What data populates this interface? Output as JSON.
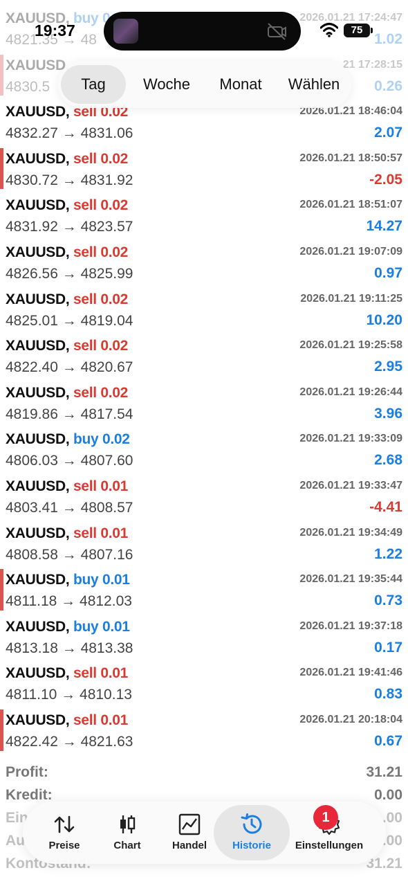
{
  "status_bar": {
    "time": "19:37",
    "battery": "75"
  },
  "period_tabs": [
    "Tag",
    "Woche",
    "Monat",
    "Wählen"
  ],
  "active_period": "Tag",
  "deals": [
    {
      "symbol": "XAUUSD,",
      "side": "buy",
      "side_label": "buy 0.0",
      "volume": "",
      "time": "2026.01.21 17:24:47",
      "prices": "4821.35 → 48",
      "profit": "1.02",
      "positive": true,
      "faded": true,
      "marked": false
    },
    {
      "symbol": "XAUUSD,",
      "side": "buy",
      "side_label": "",
      "volume": "",
      "time": "21 17:28:15",
      "prices": "4830.5",
      "profit": "0.26",
      "positive": true,
      "faded": true,
      "marked": true
    },
    {
      "symbol": "XAUUSD,",
      "side": "sell",
      "side_label": "sell 0.02",
      "time": "2026.01.21 18:46:04",
      "prices": "4832.27 → 4831.06",
      "profit": "2.07",
      "positive": true,
      "faded": false,
      "marked": false
    },
    {
      "symbol": "XAUUSD,",
      "side": "sell",
      "side_label": "sell 0.02",
      "time": "2026.01.21 18:50:57",
      "prices": "4830.72 → 4831.92",
      "profit": "-2.05",
      "positive": false,
      "faded": false,
      "marked": true
    },
    {
      "symbol": "XAUUSD,",
      "side": "sell",
      "side_label": "sell 0.02",
      "time": "2026.01.21 18:51:07",
      "prices": "4831.92 → 4823.57",
      "profit": "14.27",
      "positive": true,
      "faded": false,
      "marked": false
    },
    {
      "symbol": "XAUUSD,",
      "side": "sell",
      "side_label": "sell 0.02",
      "time": "2026.01.21 19:07:09",
      "prices": "4826.56 → 4825.99",
      "profit": "0.97",
      "positive": true,
      "faded": false,
      "marked": false
    },
    {
      "symbol": "XAUUSD,",
      "side": "sell",
      "side_label": "sell 0.02",
      "time": "2026.01.21 19:11:25",
      "prices": "4825.01 → 4819.04",
      "profit": "10.20",
      "positive": true,
      "faded": false,
      "marked": false
    },
    {
      "symbol": "XAUUSD,",
      "side": "sell",
      "side_label": "sell 0.02",
      "time": "2026.01.21 19:25:58",
      "prices": "4822.40 → 4820.67",
      "profit": "2.95",
      "positive": true,
      "faded": false,
      "marked": false
    },
    {
      "symbol": "XAUUSD,",
      "side": "sell",
      "side_label": "sell 0.02",
      "time": "2026.01.21 19:26:44",
      "prices": "4819.86 → 4817.54",
      "profit": "3.96",
      "positive": true,
      "faded": false,
      "marked": false
    },
    {
      "symbol": "XAUUSD,",
      "side": "buy",
      "side_label": "buy 0.02",
      "time": "2026.01.21 19:33:09",
      "prices": "4806.03 → 4807.60",
      "profit": "2.68",
      "positive": true,
      "faded": false,
      "marked": false
    },
    {
      "symbol": "XAUUSD,",
      "side": "sell",
      "side_label": "sell 0.01",
      "time": "2026.01.21 19:33:47",
      "prices": "4803.41 → 4808.57",
      "profit": "-4.41",
      "positive": false,
      "faded": false,
      "marked": false
    },
    {
      "symbol": "XAUUSD,",
      "side": "sell",
      "side_label": "sell 0.01",
      "time": "2026.01.21 19:34:49",
      "prices": "4808.58 → 4807.16",
      "profit": "1.22",
      "positive": true,
      "faded": false,
      "marked": false
    },
    {
      "symbol": "XAUUSD,",
      "side": "buy",
      "side_label": "buy 0.01",
      "time": "2026.01.21 19:35:44",
      "prices": "4811.18 → 4812.03",
      "profit": "0.73",
      "positive": true,
      "faded": false,
      "marked": true
    },
    {
      "symbol": "XAUUSD,",
      "side": "buy",
      "side_label": "buy 0.01",
      "time": "2026.01.21 19:37:18",
      "prices": "4813.18 → 4813.38",
      "profit": "0.17",
      "positive": true,
      "faded": false,
      "marked": false
    },
    {
      "symbol": "XAUUSD,",
      "side": "sell",
      "side_label": "sell 0.01",
      "time": "2026.01.21 19:41:46",
      "prices": "4811.10 → 4810.13",
      "profit": "0.83",
      "positive": true,
      "faded": false,
      "marked": false
    },
    {
      "symbol": "XAUUSD,",
      "side": "sell",
      "side_label": "sell 0.01",
      "time": "2026.01.21 20:18:04",
      "prices": "4822.42 → 4821.63",
      "profit": "0.67",
      "positive": true,
      "faded": false,
      "marked": true
    }
  ],
  "summary": [
    {
      "label": "Profit:",
      "value": "31.21"
    },
    {
      "label": "Kredit:",
      "value": "0.00"
    },
    {
      "label": "Ein",
      "value": ".00"
    },
    {
      "label": "Au",
      "value": ".00"
    },
    {
      "label": "Kontostand:",
      "value": "31.21"
    }
  ],
  "nav": [
    {
      "label": "Preise",
      "icon": "sort-arrows-icon"
    },
    {
      "label": "Chart",
      "icon": "candlestick-icon"
    },
    {
      "label": "Handel",
      "icon": "trade-chart-icon"
    },
    {
      "label": "Historie",
      "icon": "history-clock-icon"
    },
    {
      "label": "Einstellungen",
      "icon": "gear-icon"
    }
  ],
  "active_nav": "Historie",
  "settings_badge": "1",
  "colors": {
    "sell": "#d93a32",
    "buy": "#1a7fe0",
    "badge": "#e8283a"
  }
}
